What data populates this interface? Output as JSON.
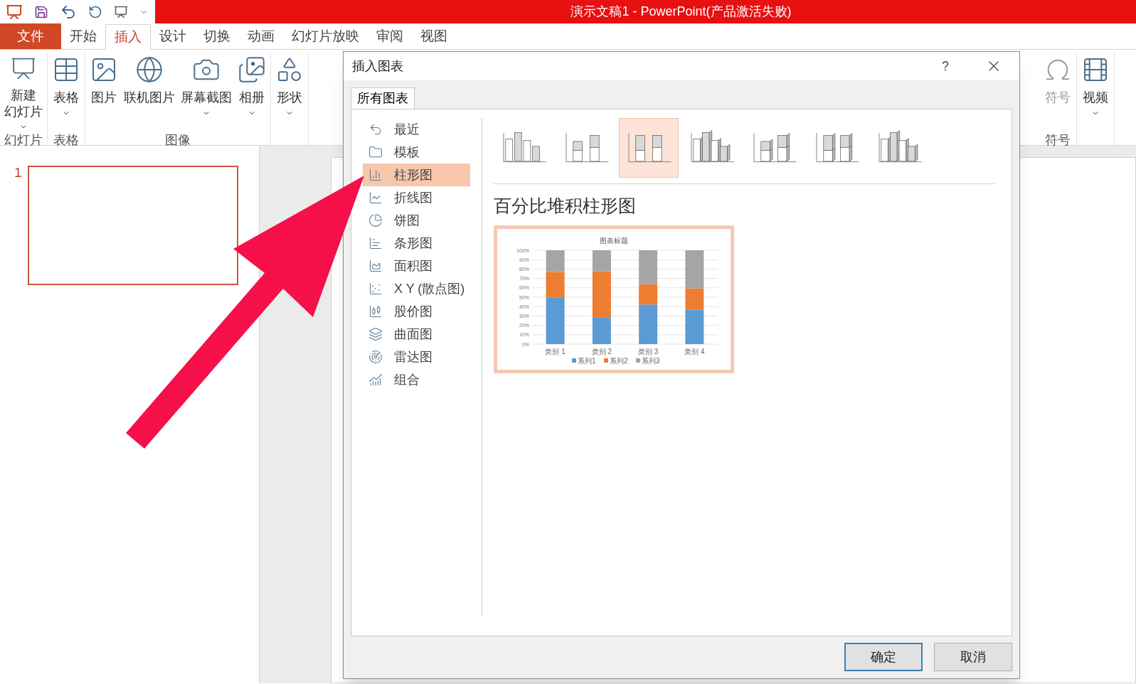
{
  "window": {
    "title": "演示文稿1 -  PowerPoint(产品激活失败)"
  },
  "ribbon_tabs": [
    {
      "label": "文件",
      "kind": "file",
      "selected": false
    },
    {
      "label": "开始",
      "kind": "tab",
      "selected": false
    },
    {
      "label": "插入",
      "kind": "tab",
      "selected": true
    },
    {
      "label": "设计",
      "kind": "tab",
      "selected": false
    },
    {
      "label": "切换",
      "kind": "tab",
      "selected": false
    },
    {
      "label": "动画",
      "kind": "tab",
      "selected": false
    },
    {
      "label": "幻灯片放映",
      "kind": "tab",
      "selected": false
    },
    {
      "label": "审阅",
      "kind": "tab",
      "selected": false
    },
    {
      "label": "视图",
      "kind": "tab",
      "selected": false
    }
  ],
  "ribbon_groups": [
    {
      "label": "幻灯片",
      "buttons": [
        {
          "lines": [
            "新建",
            "幻灯片"
          ],
          "dropdown": true
        }
      ]
    },
    {
      "label": "表格",
      "buttons": [
        {
          "lines": [
            "表格"
          ],
          "dropdown": true
        }
      ]
    },
    {
      "label": "图像",
      "buttons": [
        {
          "lines": [
            "图片"
          ],
          "dropdown": false
        },
        {
          "lines": [
            "联机图片"
          ],
          "dropdown": false
        },
        {
          "lines": [
            "屏幕截图"
          ],
          "dropdown": true
        },
        {
          "lines": [
            "相册"
          ],
          "dropdown": true
        }
      ]
    },
    {
      "buttons": [
        {
          "lines": [
            "形状"
          ],
          "dropdown": true
        }
      ]
    }
  ],
  "ribbon_groups_right": [
    {
      "label": "符号",
      "buttons": [
        {
          "lines": [
            "符号"
          ],
          "dropdown": false,
          "disabled": true
        }
      ]
    },
    {
      "buttons": [
        {
          "lines": [
            "视频"
          ],
          "dropdown": true,
          "disabled": false
        }
      ]
    }
  ],
  "slides": [
    {
      "number": "1",
      "selected": true
    }
  ],
  "dialog": {
    "title": "插入图表",
    "help": "?",
    "tabs": [
      {
        "label": "所有图表",
        "selected": true
      }
    ],
    "categories": [
      {
        "label": "最近",
        "selected": false
      },
      {
        "label": "模板",
        "selected": false
      },
      {
        "label": "柱形图",
        "selected": true
      },
      {
        "label": "折线图",
        "selected": false
      },
      {
        "label": "饼图",
        "selected": false
      },
      {
        "label": "条形图",
        "selected": false
      },
      {
        "label": "面积图",
        "selected": false
      },
      {
        "label": "X Y (散点图)",
        "selected": false
      },
      {
        "label": "股价图",
        "selected": false
      },
      {
        "label": "曲面图",
        "selected": false
      },
      {
        "label": "雷达图",
        "selected": false
      },
      {
        "label": "组合",
        "selected": false
      }
    ],
    "chart_types": [
      {
        "kind": "clustered",
        "selected": false
      },
      {
        "kind": "stacked",
        "selected": false
      },
      {
        "kind": "percent",
        "selected": true
      },
      {
        "kind": "clustered3d",
        "selected": false
      },
      {
        "kind": "stacked3d",
        "selected": false
      },
      {
        "kind": "percent3d",
        "selected": false
      },
      {
        "kind": "column3d",
        "selected": false
      }
    ],
    "heading": "百分比堆积柱形图",
    "preview": {
      "chart_data": {
        "type": "bar",
        "stacked": true,
        "grid": true,
        "legend": "bottom",
        "title": "图表标题",
        "categories": [
          "类别 1",
          "类别 2",
          "类别 3",
          "类别 4"
        ],
        "series": [
          {
            "name": "系列1",
            "color": "#5b9bd5",
            "values": [
              49.4,
              28.1,
              42.2,
              36.6
            ]
          },
          {
            "name": "系列2",
            "color": "#ed7d31",
            "values": [
              27.6,
              49.4,
              21.7,
              22.8
            ]
          },
          {
            "name": "系列3",
            "color": "#a5a5a5",
            "values": [
              23.0,
              22.5,
              36.1,
              40.6
            ]
          }
        ],
        "ylim": [
          0,
          100
        ],
        "yticks": [
          {
            "value": 0,
            "label": "0%"
          },
          {
            "value": 10,
            "label": "10%"
          },
          {
            "value": 20,
            "label": "20%"
          },
          {
            "value": 30,
            "label": "30%"
          },
          {
            "value": 40,
            "label": "40%"
          },
          {
            "value": 50,
            "label": "50%"
          },
          {
            "value": 60,
            "label": "60%"
          },
          {
            "value": 70,
            "label": "70%"
          },
          {
            "value": 80,
            "label": "80%"
          },
          {
            "value": 90,
            "label": "90%"
          },
          {
            "value": 100,
            "label": "100%"
          }
        ]
      }
    },
    "buttons": [
      {
        "label": "确定",
        "default": true
      },
      {
        "label": "取消",
        "default": false
      }
    ]
  }
}
